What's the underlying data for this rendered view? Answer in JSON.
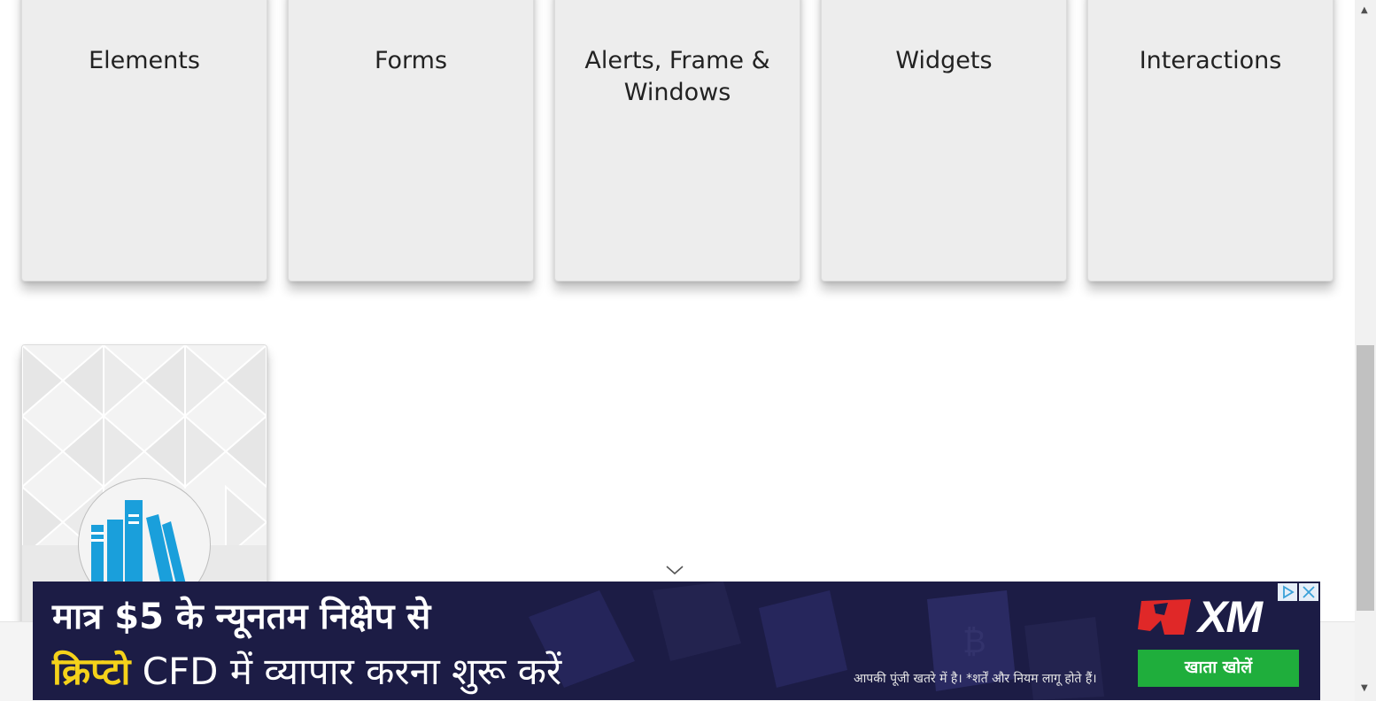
{
  "cards": [
    {
      "title": "Elements"
    },
    {
      "title": "Forms"
    },
    {
      "title": "Alerts, Frame & Windows"
    },
    {
      "title": "Widgets"
    },
    {
      "title": "Interactions"
    }
  ],
  "ad": {
    "line1_prefix": "मात्र ",
    "line1_amount": "$5",
    "line1_suffix": " के न्यूनतम निक्षेप से",
    "line2_highlight": "क्रिप्टो",
    "line2_rest": " CFD में  व्यापार करना शुरू करें",
    "disclaimer": "आपकी पूंजी खतरे में है। *शर्तें और नियम लागू होते हैं।",
    "brand": "XM",
    "cta_label": "खाता खोलें",
    "colors": {
      "background": "#1c1c45",
      "cta": "#1fae3c",
      "highlight": "#f5d21a",
      "brand_red": "#e02828"
    }
  },
  "icons": {
    "card6_icon": "books-icon",
    "scroll_hint": "chevron-down-icon",
    "ad_info": "adchoices-icon",
    "ad_close": "close-icon"
  }
}
